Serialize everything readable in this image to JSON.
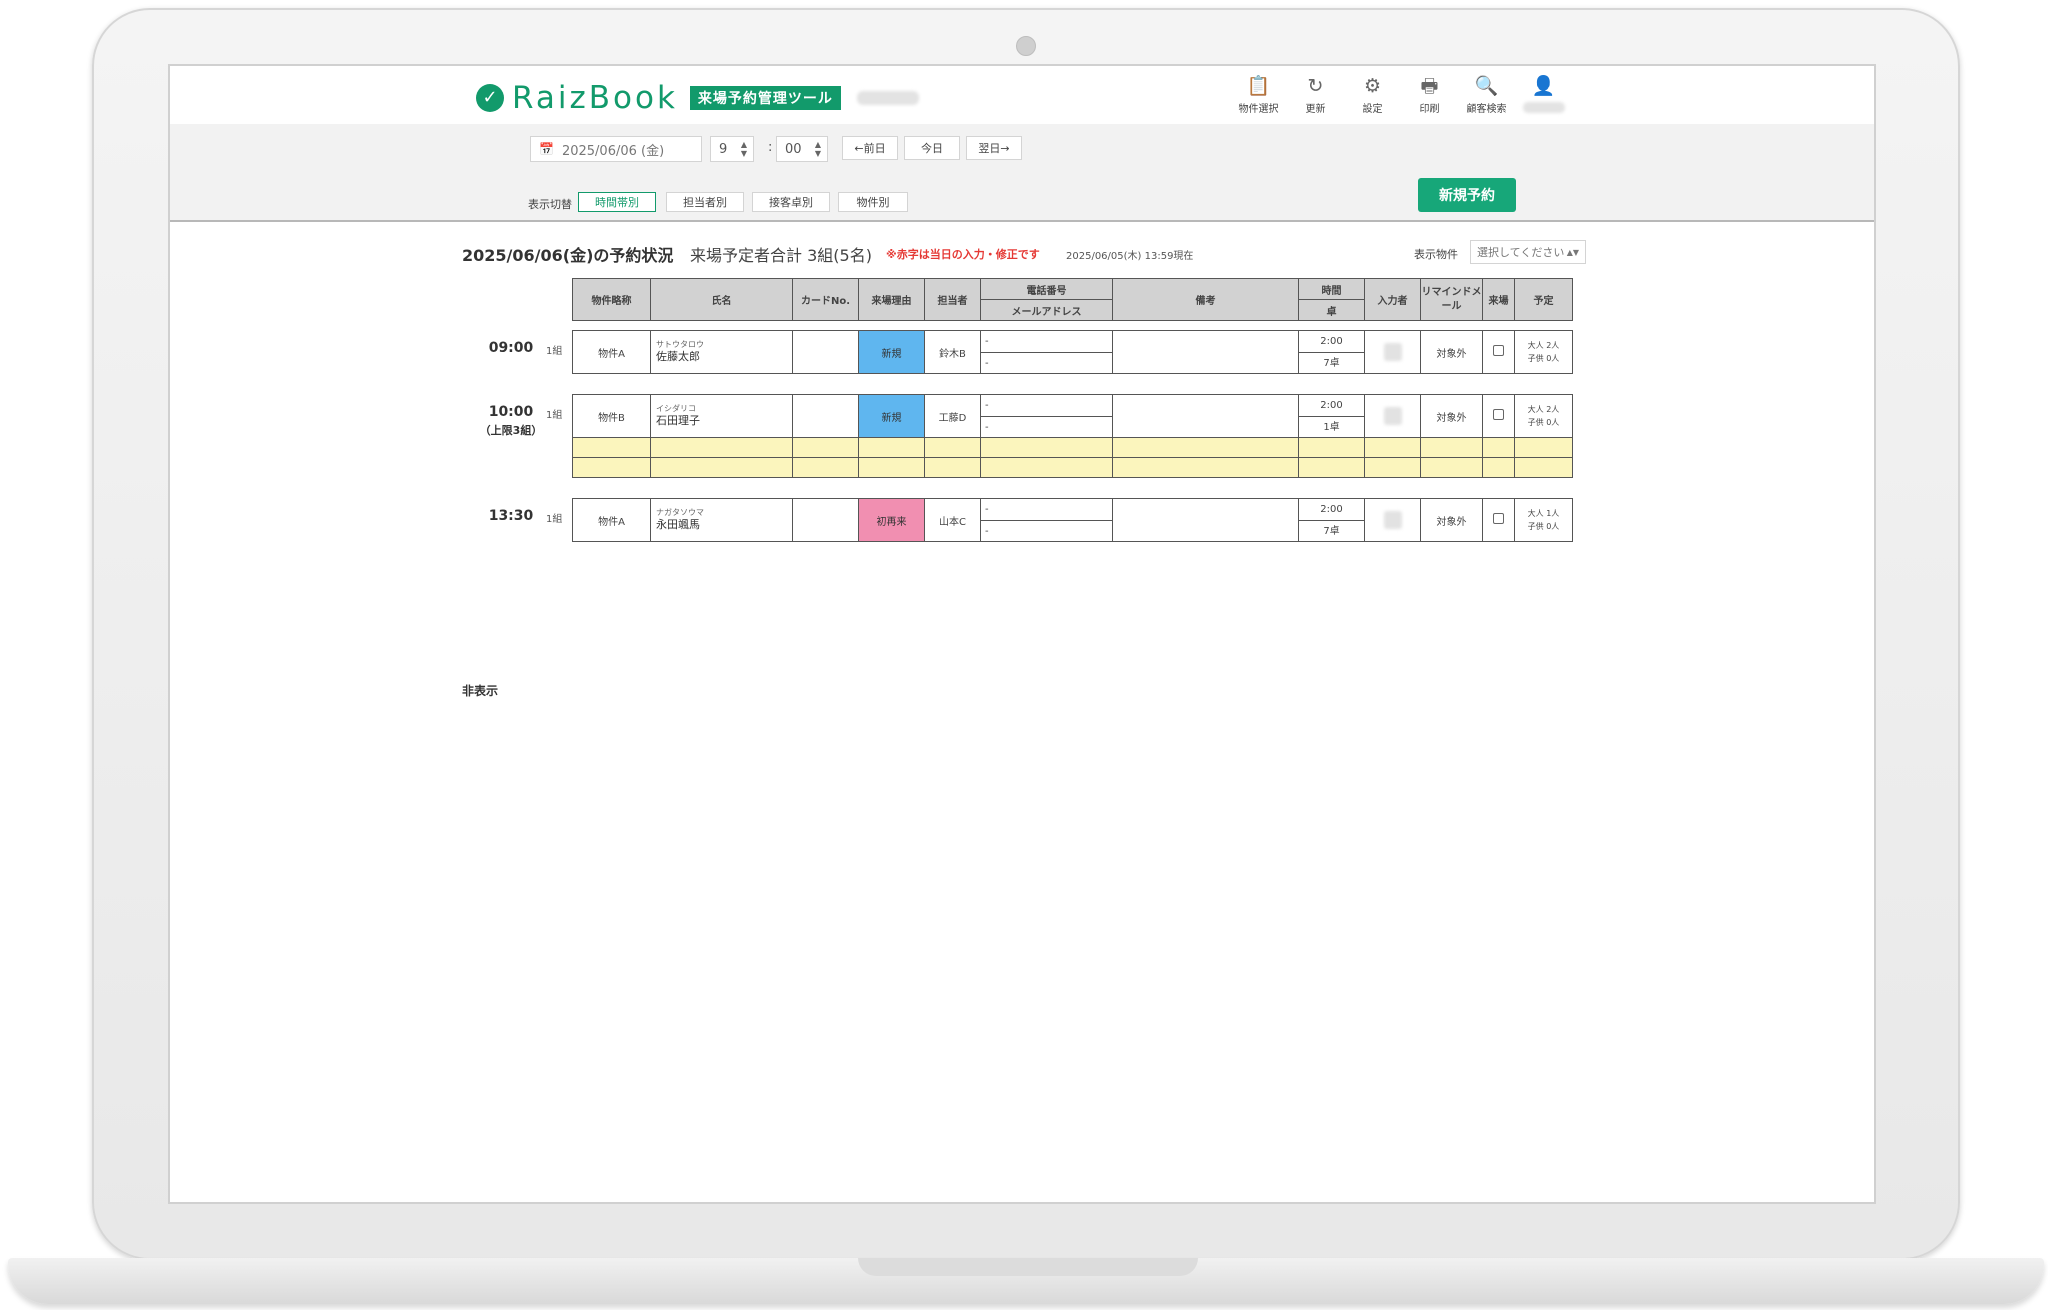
{
  "brand": {
    "name": "RaizBook",
    "badge": "来場予約管理ツール"
  },
  "toolbar": [
    {
      "icon": "clipboard-icon",
      "glyph": "📋",
      "label": "物件選択"
    },
    {
      "icon": "refresh-icon",
      "glyph": "↻",
      "label": "更新"
    },
    {
      "icon": "gear-icon",
      "glyph": "⚙",
      "label": "設定"
    },
    {
      "icon": "print-icon",
      "glyph": "🖶",
      "label": "印刷"
    },
    {
      "icon": "search-icon",
      "glyph": "🔍",
      "label": "顧客検索"
    },
    {
      "icon": "user-icon",
      "glyph": "👤",
      "label": ""
    }
  ],
  "controls": {
    "date": "2025/06/06 (金)",
    "hour": "9",
    "minute": "00",
    "prev_day": "←前日",
    "today": "今日",
    "next_day": "翌日→",
    "view_label": "表示切替",
    "views": [
      "時間帯別",
      "担当者別",
      "接客卓別",
      "物件別"
    ],
    "active_view": "時間帯別",
    "new_reservation": "新規予約"
  },
  "status": {
    "title": "2025/06/06(金)の予約状況",
    "total": "来場予定者合計 3組(5名)",
    "note": "※赤字は当日の入力・修正です",
    "as_of": "2025/06/05(木) 13:59現在",
    "filter_label": "表示物件",
    "filter_placeholder": "選択してください"
  },
  "table": {
    "headers": {
      "property": "物件略称",
      "name": "氏名",
      "card": "カードNo.",
      "reason": "来場理由",
      "staff": "担当者",
      "phone": "電話番号",
      "email": "メールアドレス",
      "note": "備考",
      "time": "時間",
      "desk": "卓",
      "entered_by": "入力者",
      "remind": "リマインドメール",
      "visited": "来場",
      "plan": "予定"
    },
    "slots": [
      {
        "time": "09:00",
        "limit": "",
        "count": "1組",
        "rows": [
          {
            "property": "物件A",
            "kana": "サトウタロウ",
            "name": "佐藤太郎",
            "card": "",
            "reason": "新規",
            "reason_color": "#5fb6ef",
            "staff": "鈴木B",
            "phone": "-",
            "email": "-",
            "note": "",
            "duration": "2:00",
            "desk": "7卓",
            "remind": "対象外",
            "adults": "大人 2人",
            "children": "子供 0人"
          }
        ],
        "empty_rows": 0
      },
      {
        "time": "10:00",
        "limit": "（上限3組）",
        "count": "1組",
        "rows": [
          {
            "property": "物件B",
            "kana": "イシダリコ",
            "name": "石田理子",
            "card": "",
            "reason": "新規",
            "reason_color": "#5fb6ef",
            "staff": "工藤D",
            "phone": "-",
            "email": "-",
            "note": "",
            "duration": "2:00",
            "desk": "1卓",
            "remind": "対象外",
            "adults": "大人 2人",
            "children": "子供 0人"
          }
        ],
        "empty_rows": 2
      },
      {
        "time": "13:30",
        "limit": "",
        "count": "1組",
        "rows": [
          {
            "property": "物件A",
            "kana": "ナガタソウマ",
            "name": "永田颯馬",
            "card": "",
            "reason": "初再来",
            "reason_color": "#f18fb1",
            "staff": "山本C",
            "phone": "-",
            "email": "-",
            "note": "",
            "duration": "2:00",
            "desk": "7卓",
            "remind": "対象外",
            "adults": "大人 1人",
            "children": "子供 0人"
          }
        ],
        "empty_rows": 0
      }
    ]
  },
  "hidden_section": "非表示"
}
